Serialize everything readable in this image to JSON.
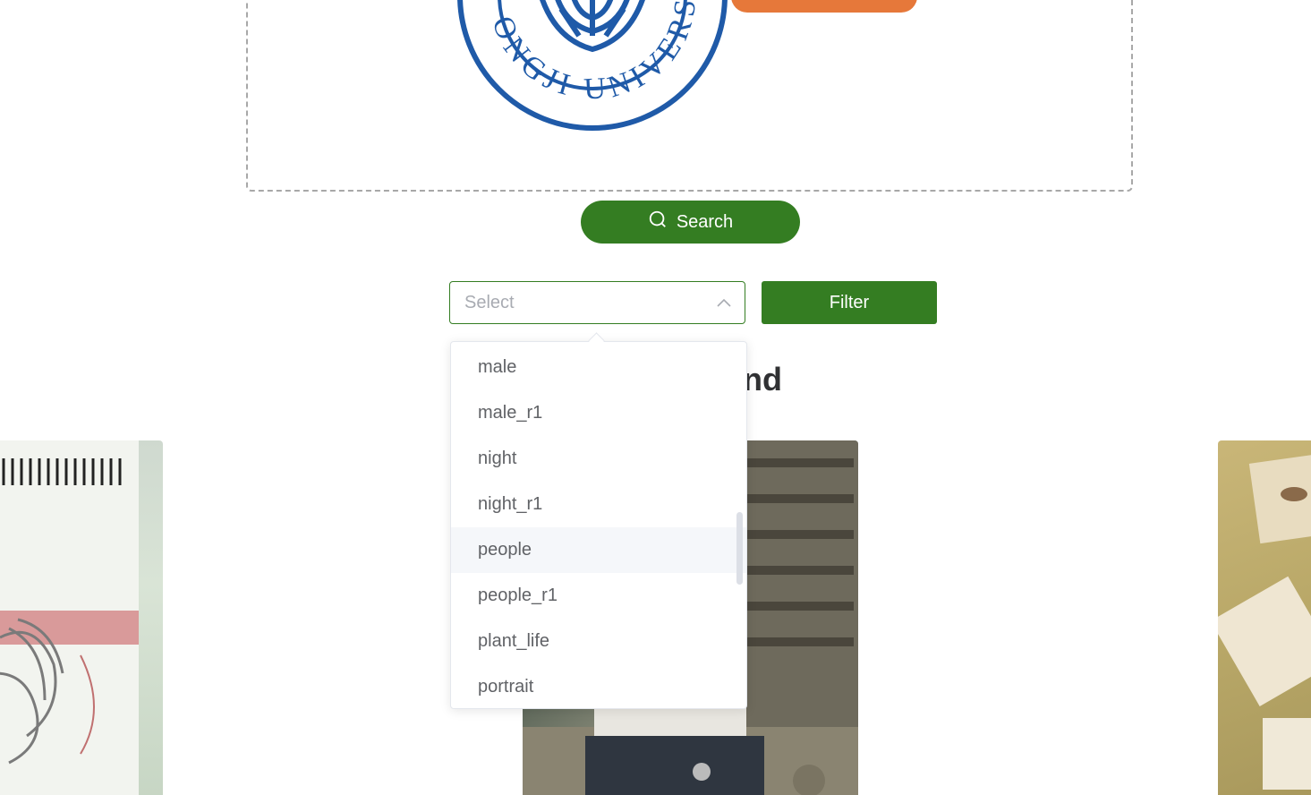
{
  "upload": {
    "logo_text": "ONGJI UNIVERSITY"
  },
  "search_button": {
    "label": "Search",
    "icon": "search-icon"
  },
  "filter": {
    "select_placeholder": "Select",
    "button_label": "Filter",
    "options": [
      "male",
      "male_r1",
      "night",
      "night_r1",
      "people",
      "people_r1",
      "plant_life",
      "portrait"
    ],
    "hovered_option": "people"
  },
  "results": {
    "heading_visible": "ound"
  },
  "colors": {
    "primary_green": "#347d22",
    "orange": "#e6783a",
    "logo_blue": "#1f5aa8"
  }
}
